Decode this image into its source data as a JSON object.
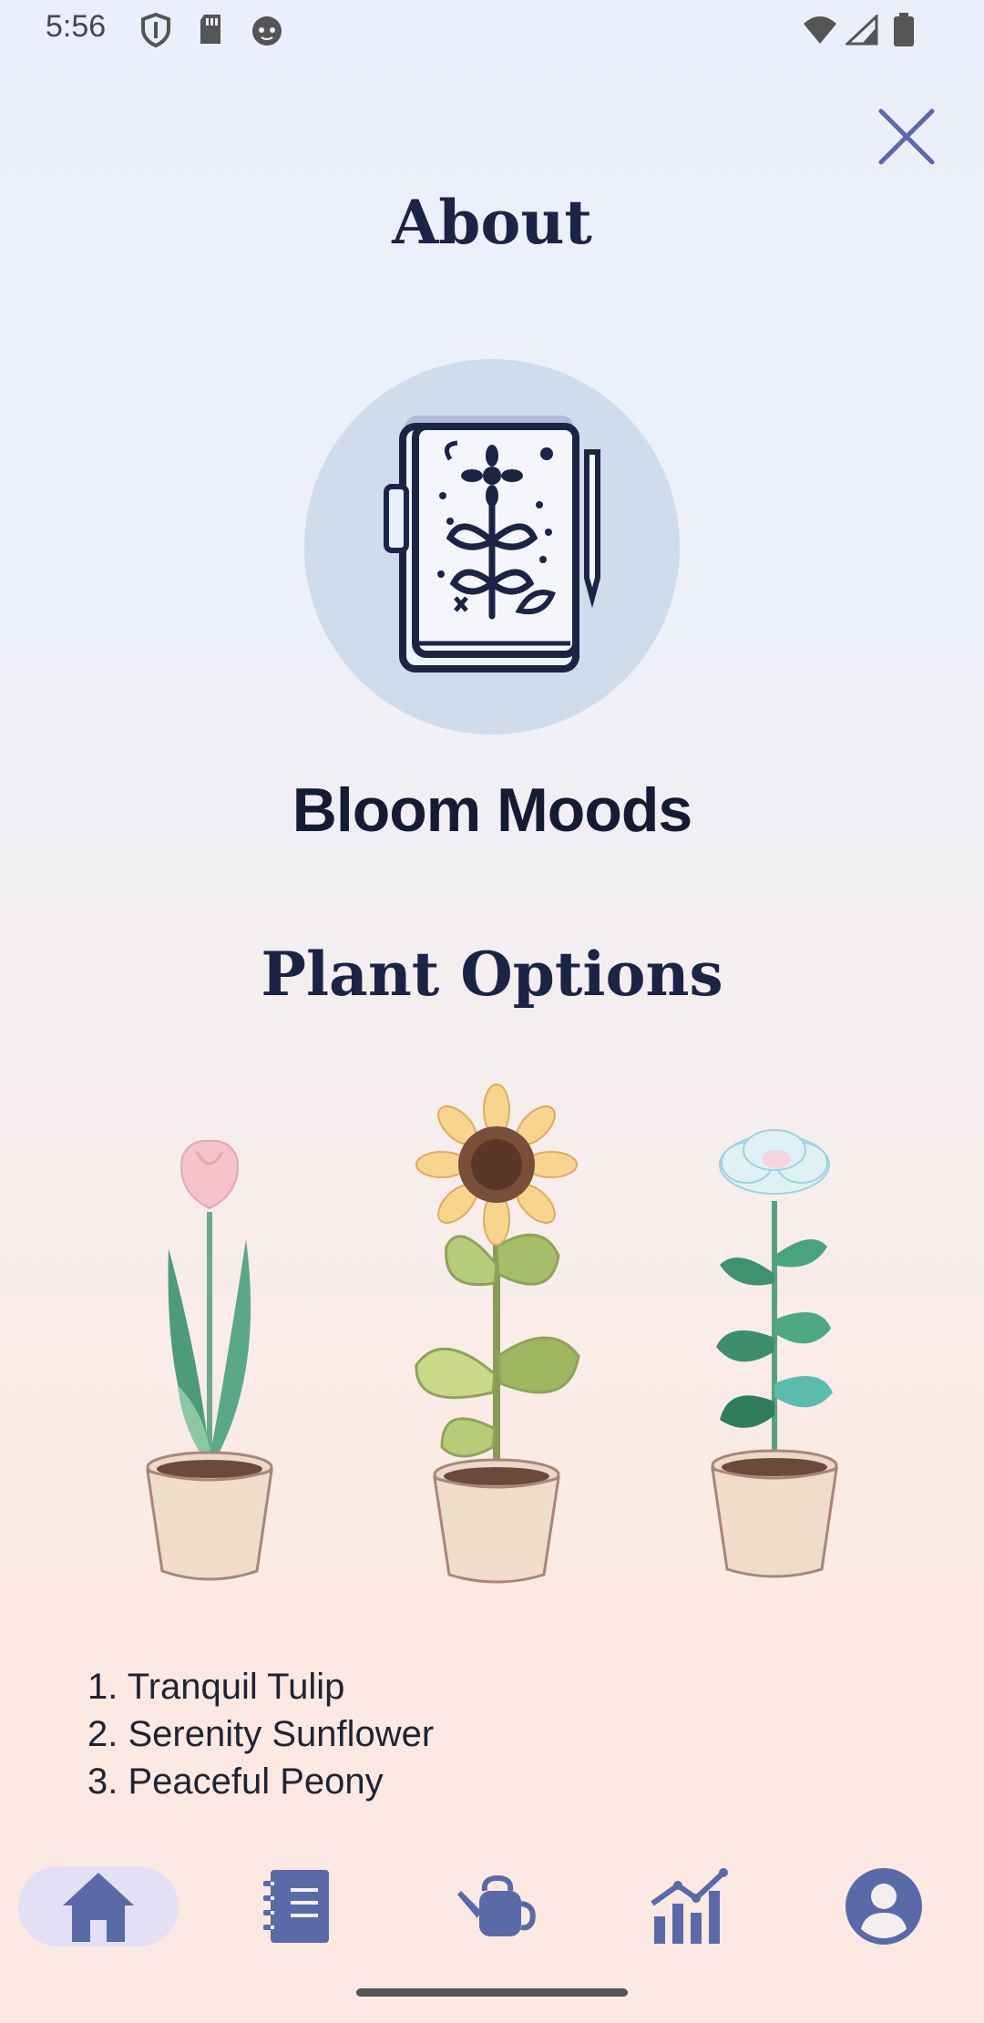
{
  "status_bar": {
    "time": "5:56"
  },
  "page": {
    "title": "About",
    "close_label": "Close"
  },
  "app": {
    "name": "Bloom Moods",
    "logo_icon": "notebook-flower-icon"
  },
  "plants": {
    "title": "Plant Options",
    "items": [
      {
        "label": "1. Tranquil Tulip",
        "icon": "tulip-pot-icon"
      },
      {
        "label": "2. Serenity Sunflower",
        "icon": "sunflower-pot-icon"
      },
      {
        "label": "3. Peaceful Peony",
        "icon": "peony-pot-icon"
      }
    ]
  },
  "nav": {
    "items": [
      {
        "name": "home",
        "icon": "home-icon",
        "active": true
      },
      {
        "name": "journal",
        "icon": "notebook-icon",
        "active": false
      },
      {
        "name": "water",
        "icon": "watering-can-icon",
        "active": false
      },
      {
        "name": "stats",
        "icon": "chart-icon",
        "active": false
      },
      {
        "name": "profile",
        "icon": "account-icon",
        "active": false
      }
    ]
  },
  "colors": {
    "accent": "#5a6aa8",
    "nav_active_bg": "#e3dff5",
    "logo_circle": "#d0dbec",
    "title": "#1c2446"
  }
}
